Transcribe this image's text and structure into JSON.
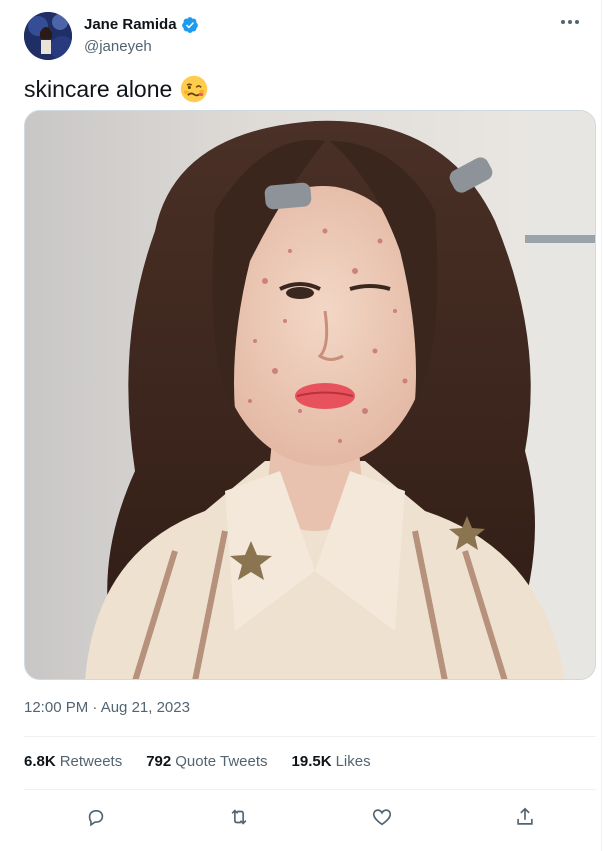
{
  "author": {
    "name": "Jane Ramida",
    "handle": "@janeyeh",
    "verified": true,
    "avatar_icon": "avatar-image"
  },
  "tweet": {
    "text": "skincare alone",
    "emoji": "woozy-face-emoji",
    "media_description_icon": "tweet-photo",
    "timestamp": "12:00 PM · Aug 21, 2023"
  },
  "stats": [
    {
      "count": "6.8K",
      "label": "Retweets"
    },
    {
      "count": "792",
      "label": "Quote Tweets"
    },
    {
      "count": "19.5K",
      "label": "Likes"
    }
  ],
  "actions": [
    "reply-icon",
    "retweet-icon",
    "like-icon",
    "share-icon"
  ],
  "colors": {
    "text": "#0f1419",
    "secondary": "#536471",
    "verified": "#1d9bf0",
    "divider": "#eff3f4"
  }
}
